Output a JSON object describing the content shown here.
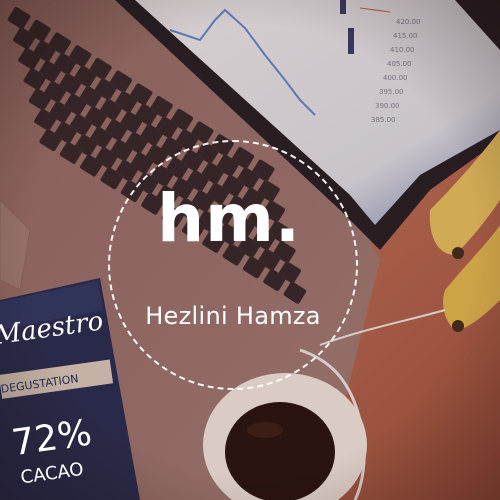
{
  "logo": {
    "mark": "hm.",
    "name": "Hezlini Hamza"
  },
  "chocolate": {
    "brand": "Maestro",
    "subtitle": "DEGUSTATION",
    "percent": "72%",
    "cacao": "CACAO"
  },
  "screen_chart": {
    "price_labels": [
      "420.00",
      "415.00",
      "410.00",
      "405.00",
      "400.00",
      "395.00",
      "390.00",
      "385.00"
    ]
  },
  "colors": {
    "logo_text": "#ffffff",
    "wrapper_navy": "#1c2a52",
    "table_warm": "#b2654e",
    "screen": "#e6edf5"
  }
}
